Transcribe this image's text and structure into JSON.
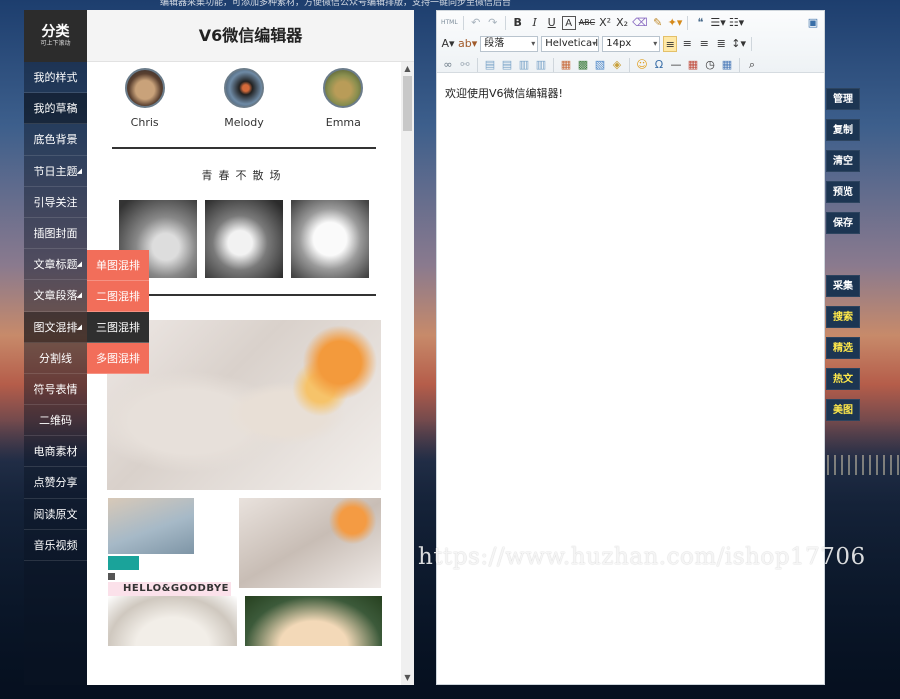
{
  "top_strip": "编辑器采集功能，可添加多种素材，方便微信公众号编辑排版，支持一键同步至微信后台",
  "sidebar": {
    "title": "分类",
    "subtitle": "可上下滚动",
    "items": [
      {
        "label": "我的样式"
      },
      {
        "label": "我的草稿"
      },
      {
        "label": "底色背景"
      },
      {
        "label": "节日主题"
      },
      {
        "label": "引导关注"
      },
      {
        "label": "插图封面"
      },
      {
        "label": "文章标题"
      },
      {
        "label": "文章段落"
      },
      {
        "label": "图文混排"
      },
      {
        "label": "分割线"
      },
      {
        "label": "符号表情"
      },
      {
        "label": "二维码"
      },
      {
        "label": "电商素材"
      },
      {
        "label": "点赞分享"
      },
      {
        "label": "阅读原文"
      },
      {
        "label": "音乐视频"
      }
    ]
  },
  "submenu": {
    "items": [
      {
        "label": "单图混排"
      },
      {
        "label": "二图混排"
      },
      {
        "label": "三图混排"
      },
      {
        "label": "多图混排"
      }
    ]
  },
  "panel": {
    "title": "V6微信编辑器",
    "avatars": [
      {
        "name": "Chris"
      },
      {
        "name": "Melody"
      },
      {
        "name": "Emma"
      }
    ],
    "section_title": "青春不散场",
    "mosaic_caption": "HELLO&GOODBYE"
  },
  "editor": {
    "font_style": "段落",
    "font_family": "Helvetica I",
    "font_size": "14px",
    "content": "欢迎使用V6微信编辑器!"
  },
  "right_buttons": {
    "group1": [
      {
        "label": "管理"
      },
      {
        "label": "复制"
      },
      {
        "label": "清空"
      },
      {
        "label": "预览"
      },
      {
        "label": "保存"
      }
    ],
    "group2": [
      {
        "label": "采集"
      },
      {
        "label": "搜索"
      },
      {
        "label": "精选"
      },
      {
        "label": "热文"
      },
      {
        "label": "美图"
      }
    ]
  },
  "watermark": "https://www.huzhan.com/ishop17706"
}
